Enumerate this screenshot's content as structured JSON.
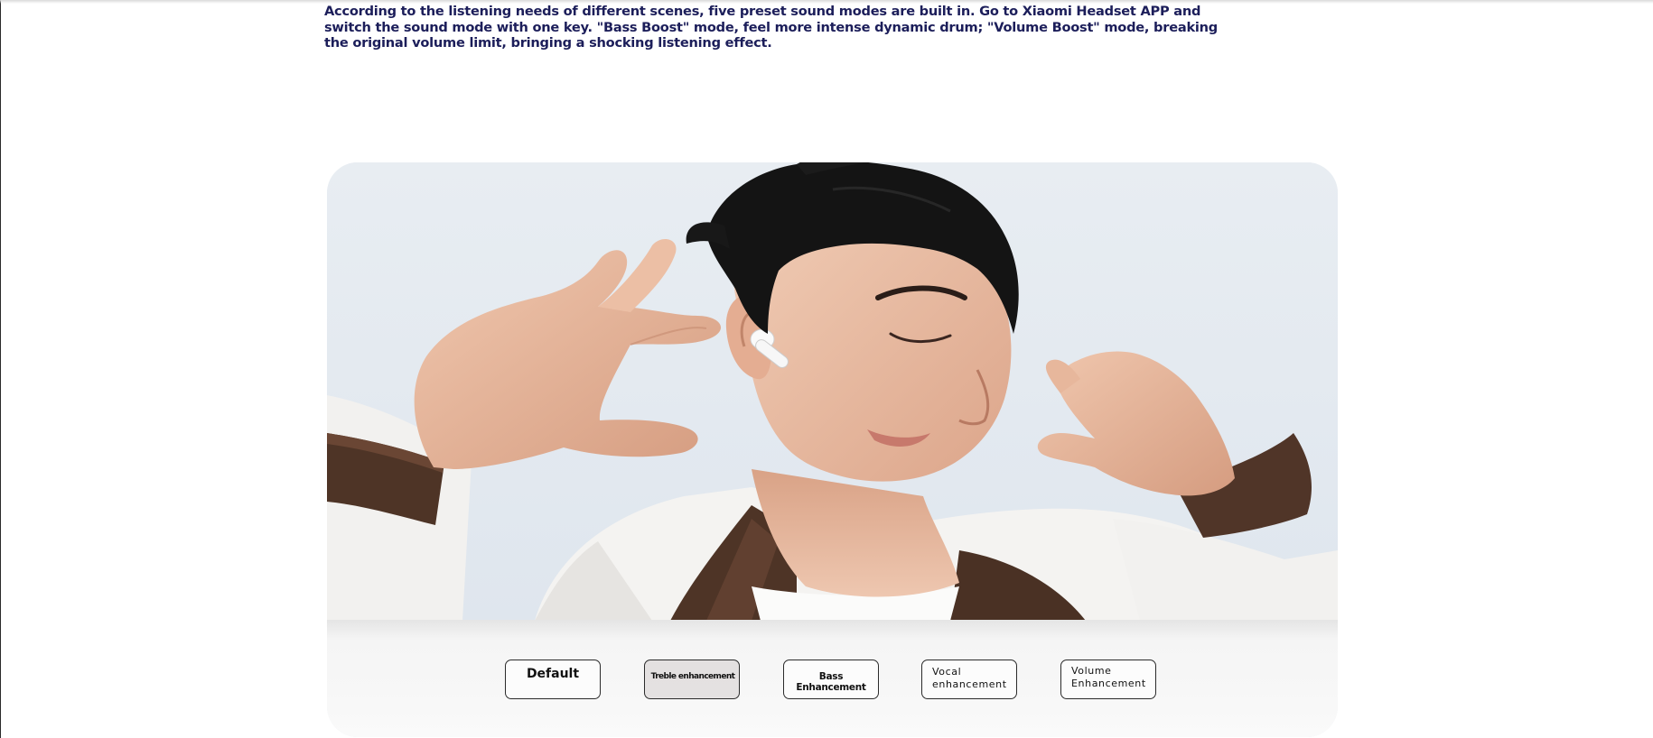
{
  "description": "According to the listening needs of different scenes, five preset sound modes are built in. Go to Xiaomi Headset APP and switch the sound mode with one key. \"Bass Boost\" mode, feel more intense dynamic drum; \"Volume Boost\" mode, breaking the original volume limit, bringing a shocking listening effect.",
  "sound_modes": [
    {
      "line1": "Default",
      "line2": ""
    },
    {
      "line1": "Treble enhancement",
      "line2": ""
    },
    {
      "line1": "Bass Enhancement",
      "line2": ""
    },
    {
      "line1": "Vocal",
      "line2": "enhancement"
    },
    {
      "line1": "Volume",
      "line2": "Enhancement"
    }
  ],
  "colors": {
    "description_text": "#1c1e5a",
    "hero_background": "#e9eef3",
    "hair": "#141414",
    "skin": "#edc2a9",
    "jacket_white": "#f4f3f1",
    "jacket_leather": "#4e3426",
    "earbud": "#fafafa",
    "button_border": "#2b2b2b"
  },
  "icons": [
    "earbud-icon"
  ]
}
